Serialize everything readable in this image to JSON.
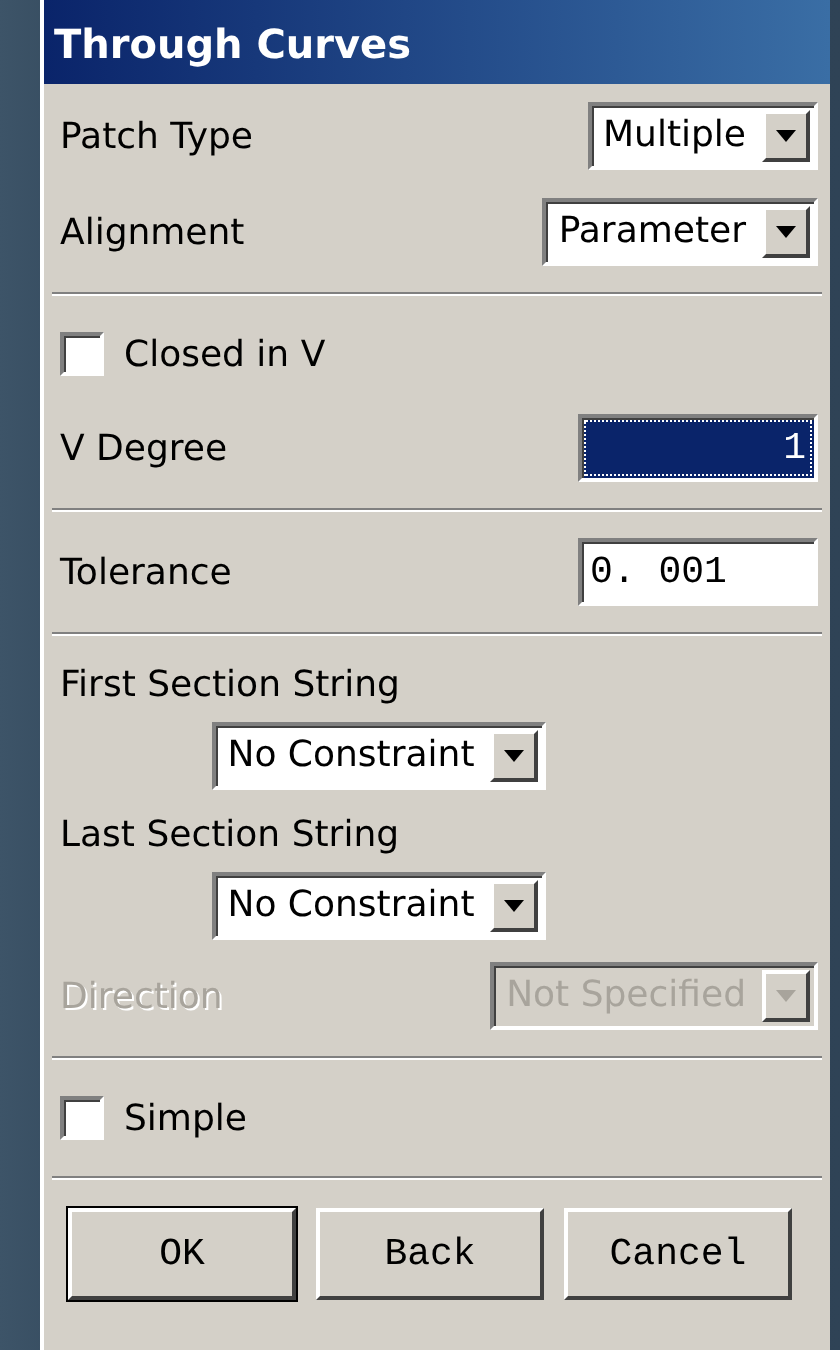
{
  "window": {
    "title": "Through Curves"
  },
  "sections": [
    [
      {
        "kind": "select",
        "label": "Patch Type",
        "value": "Multiple",
        "disabled": false
      },
      {
        "kind": "select",
        "label": "Alignment",
        "value": "Parameter",
        "disabled": false
      }
    ],
    [
      {
        "kind": "checkbox",
        "label": "Closed in V",
        "checked": false
      },
      {
        "kind": "field",
        "label": "V Degree",
        "value": "1",
        "selected": true
      }
    ],
    [
      {
        "kind": "field",
        "label": "Tolerance",
        "value": "0. 001",
        "selected": false
      }
    ],
    [
      {
        "kind": "heading",
        "label": "First Section String"
      },
      {
        "kind": "centered-select",
        "value": "No Constraint",
        "disabled": false
      },
      {
        "kind": "heading",
        "label": "Last Section String"
      },
      {
        "kind": "centered-select",
        "value": "No Constraint",
        "disabled": false
      },
      {
        "kind": "select",
        "label": "Direction",
        "value": "Not Specified",
        "disabled": true
      }
    ],
    [
      {
        "kind": "checkbox",
        "label": "Simple",
        "checked": false
      }
    ]
  ],
  "buttons": [
    "OK",
    "Back",
    "Cancel"
  ]
}
